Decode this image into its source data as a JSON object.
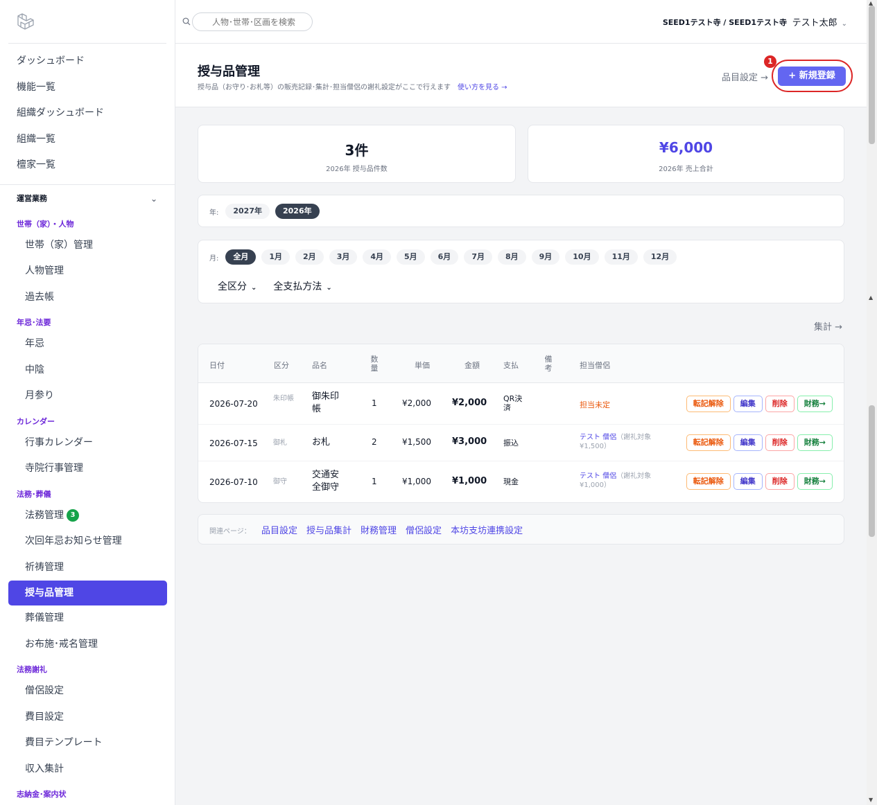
{
  "search": {
    "placeholder": "人物･世帯･区画を検索"
  },
  "topbar": {
    "org": "SEED1テスト寺 / SEED1テスト寺",
    "user": "テスト太郎",
    "caret": "⌄"
  },
  "sidebar": {
    "top_items": [
      "ダッシュボード",
      "機能一覧",
      "組織ダッシュボード",
      "組織一覧",
      "檀家一覧"
    ],
    "section": "運営業務",
    "section_chevron": "⌄",
    "groups": [
      {
        "label": "世帯（家）・人物",
        "items": [
          "世帯（家）管理",
          "人物管理",
          "過去帳"
        ]
      },
      {
        "label": "年忌･法要",
        "items": [
          "年忌",
          "中陰",
          "月参り"
        ]
      },
      {
        "label": "カレンダー",
        "items": [
          "行事カレンダー",
          "寺院行事管理"
        ]
      },
      {
        "label": "法務･葬儀",
        "items": [
          "法務管理",
          "次回年忌お知らせ管理",
          "祈祷管理",
          "授与品管理",
          "葬儀管理",
          "お布施･戒名管理"
        ]
      },
      {
        "label": "法務謝礼",
        "items": [
          "僧侶設定",
          "費目設定",
          "費目テンプレート",
          "収入集計"
        ]
      },
      {
        "label": "志納金･案内状",
        "items": []
      }
    ],
    "houmu_badge": "3",
    "active_item": "授与品管理"
  },
  "header": {
    "title": "授与品管理",
    "subtitle": "授与品（お守り･お札等）の販売記録･集計･担当僧侶の謝礼設定がここで行えます",
    "howto_link": "使い方を見る →",
    "item_settings": "品目設定 →",
    "new_button": "+ 新規登録",
    "step_number": "1"
  },
  "stats": [
    {
      "value": "3件",
      "label": "2026年 授与品件数"
    },
    {
      "value": "¥6,000",
      "label": "2026年 売上合計"
    }
  ],
  "year_filter": {
    "label": "年:",
    "options": [
      "2027年",
      "2026年"
    ],
    "selected": "2026年"
  },
  "month_filter": {
    "label": "月:",
    "options": [
      "全月",
      "1月",
      "2月",
      "3月",
      "4月",
      "5月",
      "6月",
      "7月",
      "8月",
      "9月",
      "10月",
      "11月",
      "12月"
    ],
    "selected": "全月",
    "category_select": "全区分",
    "payment_select": "全支払方法",
    "dd_arrow": "⌄"
  },
  "summary_link": "集計 →",
  "table": {
    "headers": {
      "date": "日付",
      "category": "区分",
      "name": "品名",
      "qty": "数量",
      "unit_price": "単価",
      "amount": "金額",
      "payment": "支払",
      "notes": "備考",
      "monk": "担当僧侶"
    },
    "rows": [
      {
        "date": "2026-07-20",
        "category": "朱印帳",
        "name": "御朱印帳",
        "qty": "1",
        "unit_price": "¥2,000",
        "amount": "¥2,000",
        "payment": "QR決済",
        "monk": "担当未定",
        "monk_note": ""
      },
      {
        "date": "2026-07-15",
        "category": "御札",
        "name": "お札",
        "qty": "2",
        "unit_price": "¥1,500",
        "amount": "¥3,000",
        "payment": "振込",
        "monk": "テスト 僧侶",
        "monk_note": "（謝礼対象 ¥1,500）"
      },
      {
        "date": "2026-07-10",
        "category": "御守",
        "name": "交通安全御守",
        "qty": "1",
        "unit_price": "¥1,000",
        "amount": "¥1,000",
        "payment": "現金",
        "monk": "テスト 僧侶",
        "monk_note": "（謝礼対象 ¥1,000）"
      }
    ],
    "actions": {
      "transfer": "転記解除",
      "edit": "編集",
      "delete": "削除",
      "finance": "財務→"
    }
  },
  "related": {
    "label": "関連ページ：",
    "links": [
      "品目設定",
      "授与品集計",
      "財務管理",
      "僧侶設定",
      "本坊支坊連携設定"
    ]
  },
  "colors": {
    "accent": "#4f46e5",
    "button": "#6366f1",
    "highlight": "#dc2626"
  }
}
